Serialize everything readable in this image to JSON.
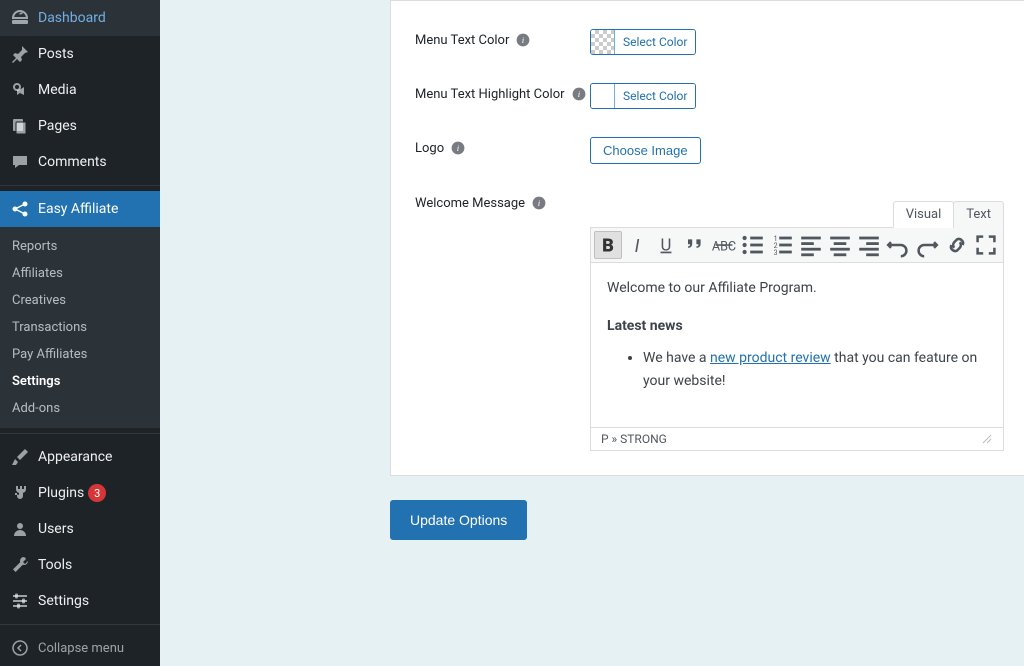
{
  "sidebar": {
    "main_items_top": [
      {
        "name": "dashboard",
        "label": "Dashboard",
        "icon": "dashboard"
      },
      {
        "name": "posts",
        "label": "Posts",
        "icon": "pin"
      },
      {
        "name": "media",
        "label": "Media",
        "icon": "media"
      },
      {
        "name": "pages",
        "label": "Pages",
        "icon": "pages"
      },
      {
        "name": "comments",
        "label": "Comments",
        "icon": "comment"
      }
    ],
    "active_item": {
      "name": "easy-affiliate",
      "label": "Easy Affiliate",
      "icon": "share"
    },
    "submenu": [
      {
        "name": "reports",
        "label": "Reports"
      },
      {
        "name": "affiliates",
        "label": "Affiliates"
      },
      {
        "name": "creatives",
        "label": "Creatives"
      },
      {
        "name": "transactions",
        "label": "Transactions"
      },
      {
        "name": "pay-affiliates",
        "label": "Pay Affiliates"
      },
      {
        "name": "settings",
        "label": "Settings",
        "current": true
      },
      {
        "name": "add-ons",
        "label": "Add-ons"
      }
    ],
    "main_items_bottom": [
      {
        "name": "appearance",
        "label": "Appearance",
        "icon": "brush"
      },
      {
        "name": "plugins",
        "label": "Plugins",
        "icon": "plug",
        "badge": "3"
      },
      {
        "name": "users",
        "label": "Users",
        "icon": "user"
      },
      {
        "name": "tools",
        "label": "Tools",
        "icon": "wrench"
      },
      {
        "name": "admin-settings",
        "label": "Settings",
        "icon": "sliders"
      }
    ],
    "collapse_label": "Collapse menu"
  },
  "form": {
    "menu_text_color": {
      "label": "Menu Text Color",
      "btn": "Select Color"
    },
    "menu_text_highlight": {
      "label": "Menu Text Highlight Color",
      "btn": "Select Color"
    },
    "logo": {
      "label": "Logo",
      "btn": "Choose Image"
    },
    "welcome": {
      "label": "Welcome Message"
    }
  },
  "editor": {
    "tabs": {
      "visual": "Visual",
      "text": "Text"
    },
    "content": {
      "line1": "Welcome to our Affiliate Program.",
      "heading": "Latest news",
      "bullet_pre": "We have a ",
      "bullet_link": "new product review",
      "bullet_post": " that you can feature on your website!"
    },
    "path": "P » STRONG"
  },
  "update_btn": "Update Options"
}
